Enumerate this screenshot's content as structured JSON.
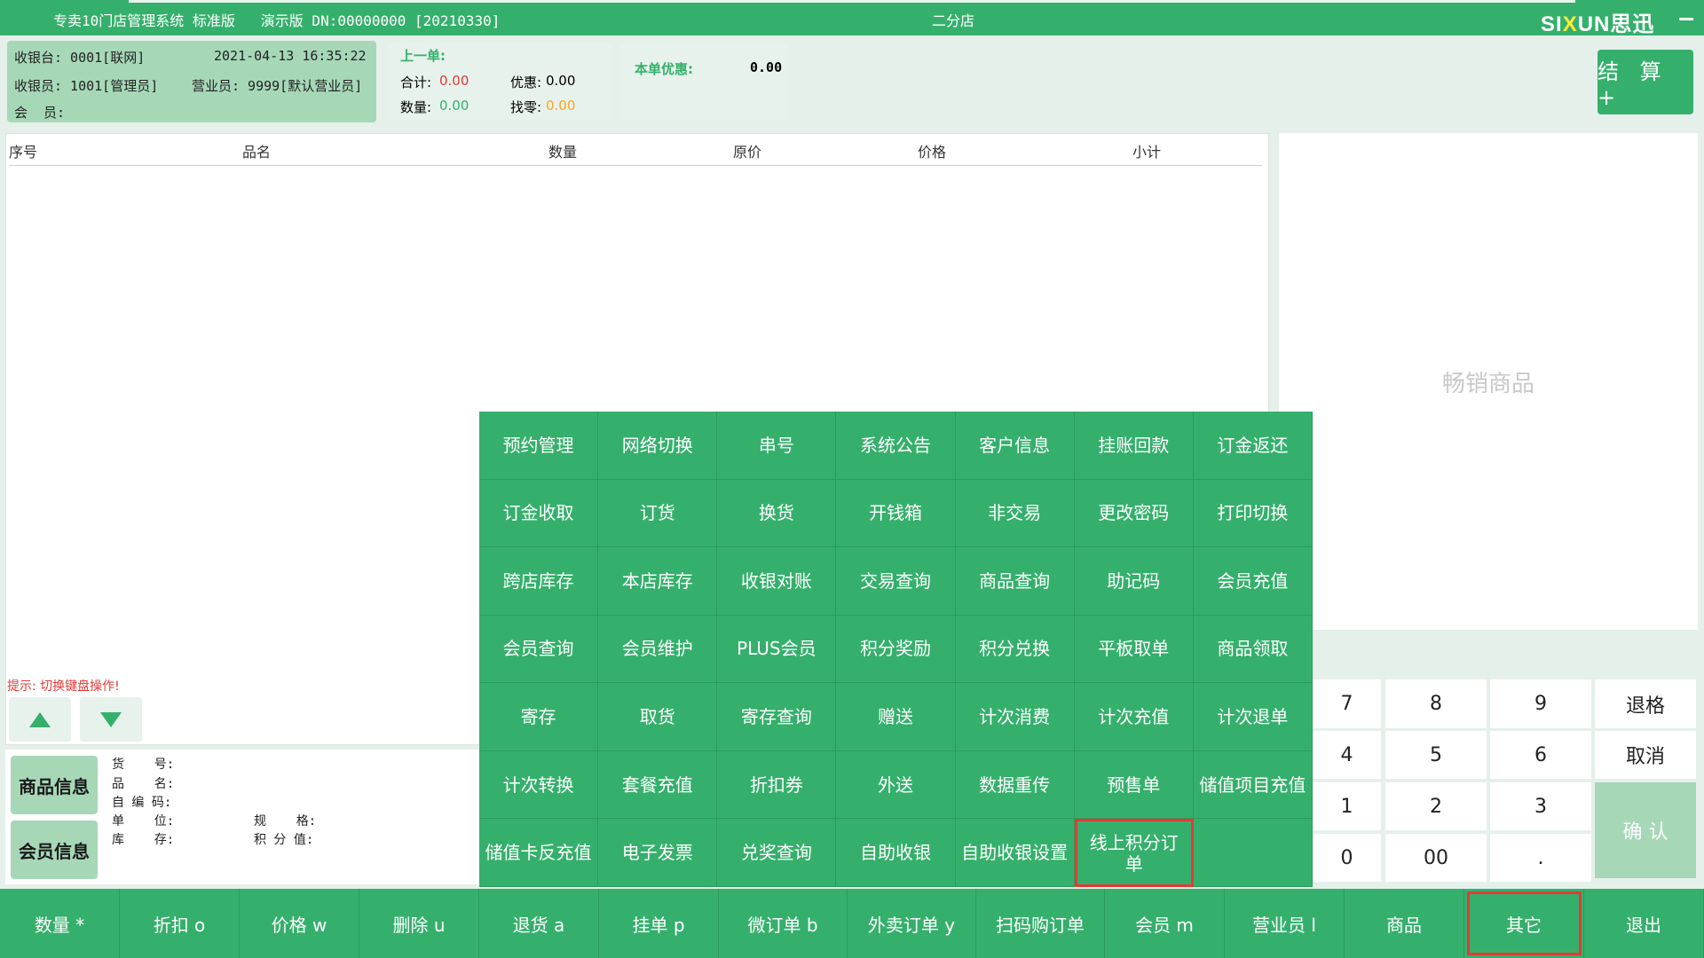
{
  "title_bar": {
    "left_text": "专卖10门店管理系统 标准版   演示版 DN:00000000 [20210330]",
    "store": "二分店",
    "logo_left": "SI",
    "logo_x": "X",
    "logo_right": "UN思迅"
  },
  "info": {
    "cashier_desk": "收银台: 0001[联网]",
    "datetime": "2021-04-13 16:35:22",
    "cashier": "收银员: 1001[管理员]",
    "salesperson": "营业员: 9999[默认营业员]",
    "member": "会  员:"
  },
  "last_order": {
    "title": "上一单:",
    "total_label": "合计:",
    "total_value": "0.00",
    "discount_label": "优惠:",
    "discount_value": "0.00",
    "qty_label": "数量:",
    "qty_value": "0.00",
    "change_label": "找零:",
    "change_value": "0.00"
  },
  "current_discount": {
    "label": "本单优惠:",
    "value": "0.00"
  },
  "checkout_button": "结 算 +",
  "table_headers": [
    "序号",
    "品名",
    "数量",
    "原价",
    "价格",
    "小计"
  ],
  "hint": "提示: 切换键盘操作!",
  "bestseller_label": "畅销商品",
  "side_buttons": {
    "product_info": "商品信息",
    "member_info": "会员信息"
  },
  "product_fields": {
    "sku": "货    号:",
    "name": "品    名:",
    "code": "自 编 码:",
    "unit": "单    位:",
    "spec": "规    格:",
    "stock": "库    存:",
    "points": "积 分 值:"
  },
  "keypad": {
    "keys": [
      "7",
      "8",
      "9",
      "4",
      "5",
      "6",
      "1",
      "2",
      "3",
      "0",
      "00",
      "."
    ],
    "backspace": "退格",
    "cancel": "取消",
    "confirm": "确 认"
  },
  "menu": {
    "rows": [
      [
        "预约管理",
        "网络切换",
        "串号",
        "系统公告",
        "客户信息",
        "挂账回款",
        "订金返还"
      ],
      [
        "订金收取",
        "订货",
        "换货",
        "开钱箱",
        "非交易",
        "更改密码",
        "打印切换"
      ],
      [
        "跨店库存",
        "本店库存",
        "收银对账",
        "交易查询",
        "商品查询",
        "助记码",
        "会员充值"
      ],
      [
        "会员查询",
        "会员维护",
        "PLUS会员",
        "积分奖励",
        "积分兑换",
        "平板取单",
        "商品领取"
      ],
      [
        "寄存",
        "取货",
        "寄存查询",
        "赠送",
        "计次消费",
        "计次充值",
        "计次退单"
      ],
      [
        "计次转换",
        "套餐充值",
        "折扣券",
        "外送",
        "数据重传",
        "预售单",
        "储值项目充值"
      ],
      [
        "储值卡反充值",
        "电子发票",
        "兑奖查询",
        "自助收银",
        "自助收银设置",
        "线上积分订单",
        ""
      ]
    ]
  },
  "bottom_bar": [
    "数量 *",
    "折扣 o",
    "价格 w",
    "删除 u",
    "退货 a",
    "挂单 p",
    "微订单 b",
    "外卖订单 y",
    "扫码购订单",
    "会员 m",
    "营业员 l",
    "商品",
    "其它",
    "退出"
  ]
}
